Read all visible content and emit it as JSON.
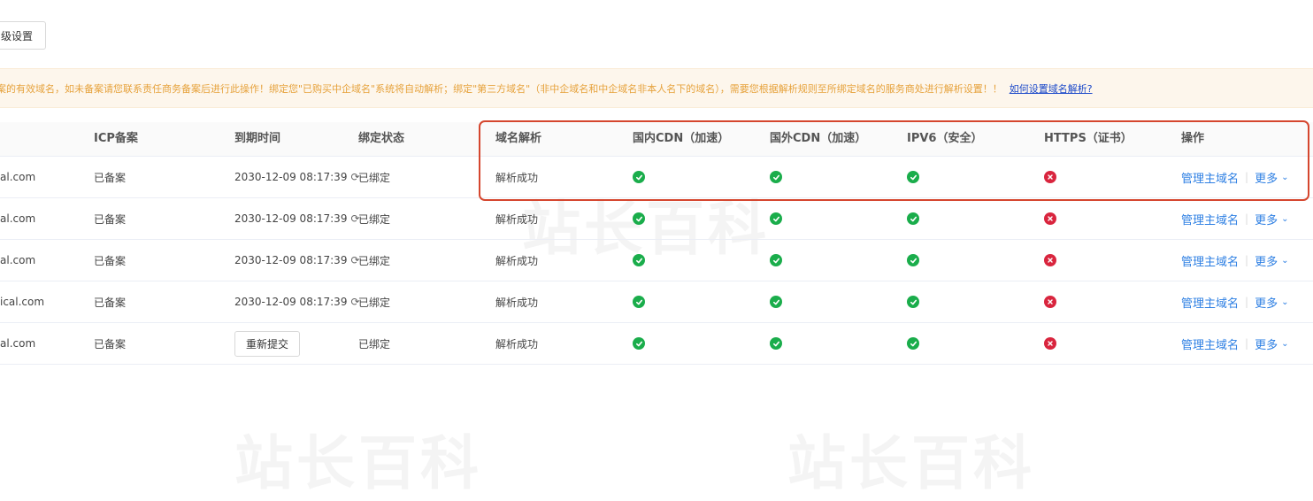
{
  "toolbar": {
    "advanced_label": "级设置"
  },
  "notice": {
    "text": "案的有效域名，如未备案请您联系责任商务备案后进行此操作！绑定您\"已购买中企域名\"系统将自动解析；绑定\"第三方域名\"（非中企域名和中企域名非本人名下的域名），需要您根据解析规则至所绑定域名的服务商处进行解析设置！！",
    "link": "如何设置域名解析?"
  },
  "table": {
    "headers": {
      "icp": "ICP备案",
      "expire": "到期时间",
      "bind": "绑定状态",
      "dns": "域名解析",
      "cdn_cn": "国内CDN（加速）",
      "cdn_intl": "国外CDN（加速）",
      "ipv6": "IPV6（安全）",
      "https": "HTTPS（证书）",
      "ops": "操作"
    },
    "rows": [
      {
        "domain": "al.com",
        "icp": "已备案",
        "expire": "2030-12-09 08:17:39",
        "bind": "已绑定",
        "dns": "解析成功",
        "manage": "管理主域名",
        "more": "更多"
      },
      {
        "domain": "al.com",
        "icp": "已备案",
        "expire": "2030-12-09 08:17:39",
        "bind": "已绑定",
        "dns": "解析成功",
        "manage": "管理主域名",
        "more": "更多"
      },
      {
        "domain": "al.com",
        "icp": "已备案",
        "expire": "2030-12-09 08:17:39",
        "bind": "已绑定",
        "dns": "解析成功",
        "manage": "管理主域名",
        "more": "更多"
      },
      {
        "domain": "ical.com",
        "icp": "已备案",
        "expire": "2030-12-09 08:17:39",
        "bind": "已绑定",
        "dns": "解析成功",
        "manage": "管理主域名",
        "more": "更多"
      },
      {
        "domain": "al.com",
        "icp": "已备案",
        "resubmit": "重新提交",
        "bind": "已绑定",
        "dns": "解析成功",
        "manage": "管理主域名",
        "more": "更多"
      }
    ],
    "status_icons": {
      "cdn_cn": "check-icon",
      "cdn_intl": "check-icon",
      "ipv6": "check-icon",
      "https": "x-icon"
    }
  },
  "colors": {
    "success": "#1aad4b",
    "error": "#d9253e",
    "link": "#2d7fe3",
    "notice_bg": "#fdf6ec",
    "notice_text": "#e6a23c",
    "highlight": "#d5462e"
  }
}
